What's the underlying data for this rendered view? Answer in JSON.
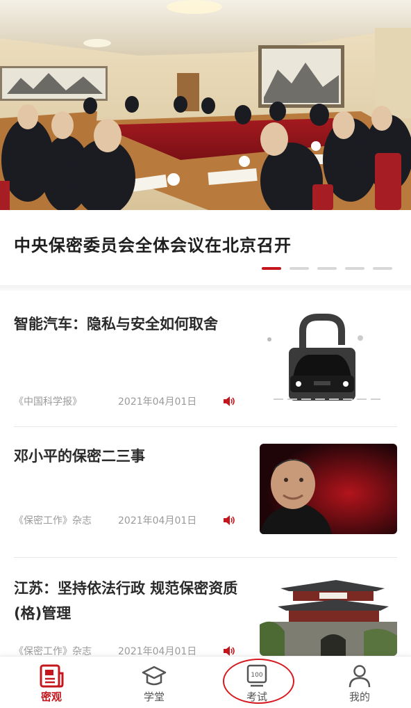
{
  "hero": {
    "title": "中央保密委员会全体会议在北京召开",
    "slide_count": 5,
    "active_slide": 1
  },
  "articles": [
    {
      "title": "智能汽车：隐私与安全如何取舍",
      "source": "《中国科学报》",
      "date": "2021年04月01日",
      "audio_icon": "speaker-icon",
      "thumb_icon": "padlock-car-image"
    },
    {
      "title": "邓小平的保密二三事",
      "source": "《保密工作》杂志",
      "date": "2021年04月01日",
      "audio_icon": "speaker-icon",
      "thumb_icon": "portrait-image"
    },
    {
      "title": "江苏：坚持依法行政  规范保密资质(格)管理",
      "source": "《保密工作》杂志",
      "date": "2021年04月01日",
      "audio_icon": "speaker-icon",
      "thumb_icon": "city-gate-image"
    }
  ],
  "tabbar": {
    "tabs": [
      {
        "label": "密观",
        "icon": "news-icon",
        "active": true
      },
      {
        "label": "学堂",
        "icon": "graduation-cap-icon",
        "active": false
      },
      {
        "label": "考试",
        "icon": "exam-score-icon",
        "active": false,
        "icon_text": "100"
      },
      {
        "label": "我的",
        "icon": "user-icon",
        "active": false
      }
    ]
  },
  "colors": {
    "accent": "#c4161c",
    "highlight_ring": "#d7191f",
    "meta_text": "#9a9a9a"
  }
}
